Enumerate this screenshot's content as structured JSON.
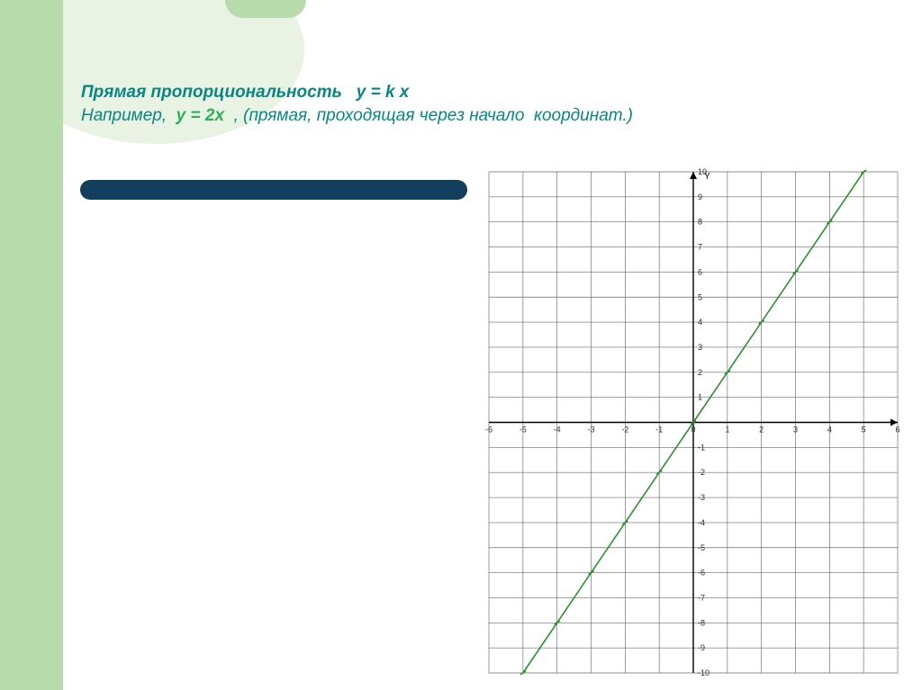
{
  "header": {
    "title_prefix": "Прямая пропорциональность   ",
    "title_formula": "y = k x",
    "example_prefix": "Например,  ",
    "example_formula": "у = 2х",
    "example_suffix": "  , (прямая, проходящая через начало  координат.)"
  },
  "chart_data": {
    "type": "line",
    "title": "",
    "xlabel": "",
    "ylabel": "",
    "x_axis_label": "",
    "y_axis_label": "Y",
    "xlim": [
      -6,
      6
    ],
    "ylim": [
      -10,
      10
    ],
    "xticks": [
      -6,
      -5,
      -4,
      -3,
      -2,
      -1,
      0,
      1,
      2,
      3,
      4,
      5,
      6
    ],
    "yticks": [
      -10,
      -9,
      -8,
      -7,
      -6,
      -5,
      -4,
      -3,
      -2,
      -1,
      0,
      1,
      2,
      3,
      4,
      5,
      6,
      7,
      8,
      9,
      10
    ],
    "series": [
      {
        "name": "y = 2x",
        "x": [
          -5,
          -4,
          -3,
          -2,
          -1,
          0,
          1,
          2,
          3,
          4,
          5
        ],
        "values": [
          -10,
          -8,
          -6,
          -4,
          -2,
          0,
          2,
          4,
          6,
          8,
          10
        ]
      }
    ]
  }
}
